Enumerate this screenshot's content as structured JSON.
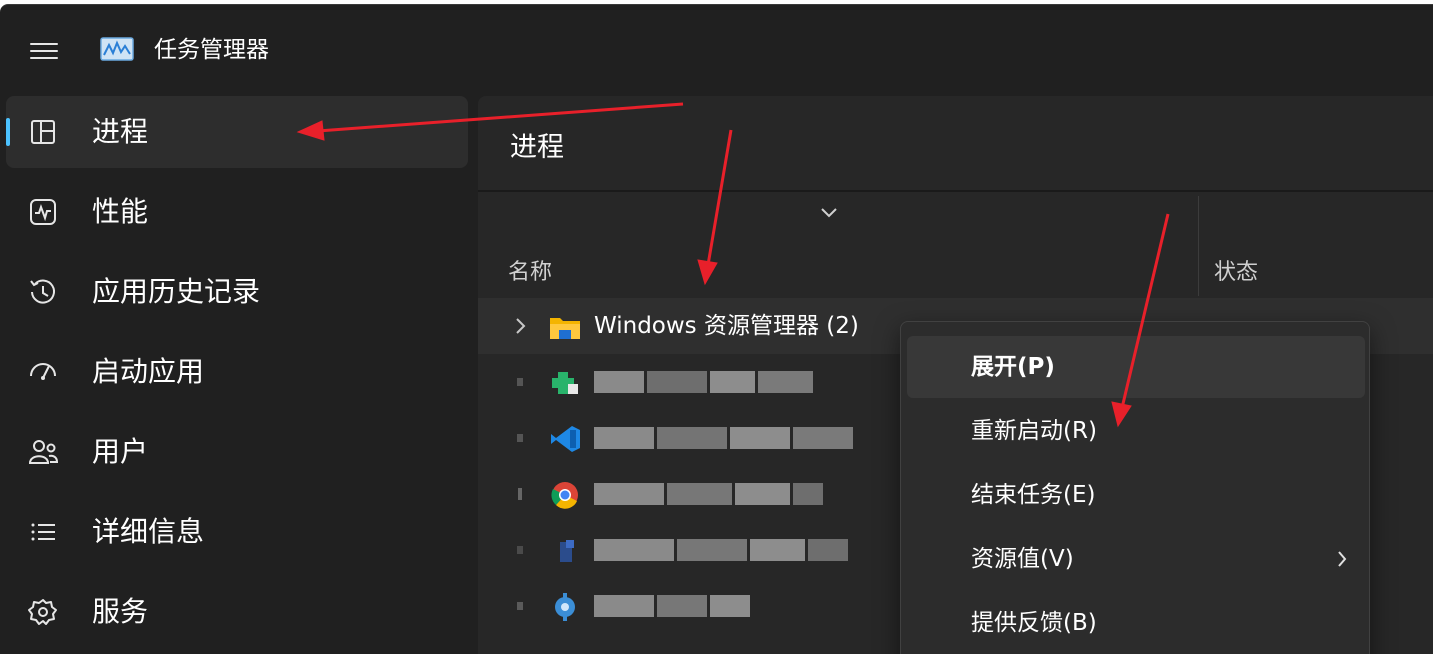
{
  "window": {
    "title": "任务管理器"
  },
  "sidebar": {
    "items": [
      {
        "label": "进程",
        "icon": "processes-icon",
        "active": true
      },
      {
        "label": "性能",
        "icon": "performance-icon"
      },
      {
        "label": "应用历史记录",
        "icon": "app-history-icon"
      },
      {
        "label": "启动应用",
        "icon": "startup-apps-icon"
      },
      {
        "label": "用户",
        "icon": "users-icon"
      },
      {
        "label": "详细信息",
        "icon": "details-icon"
      },
      {
        "label": "服务",
        "icon": "services-icon"
      }
    ]
  },
  "main": {
    "title": "进程",
    "columns": {
      "name": "名称",
      "status": "状态"
    },
    "rows": [
      {
        "label": "Windows 资源管理器 (2)",
        "icon": "file-explorer-icon",
        "expandable": true
      }
    ],
    "blurred_rows": [
      {
        "icon": "green-app-icon"
      },
      {
        "icon": "vscode-icon"
      },
      {
        "icon": "chrome-icon"
      },
      {
        "icon": "blue-app-icon"
      },
      {
        "icon": "gear-app-icon"
      }
    ]
  },
  "context_menu": {
    "items": [
      {
        "label": "展开(P)",
        "bold": true
      },
      {
        "label": "重新启动(R)"
      },
      {
        "label": "结束任务(E)"
      },
      {
        "label": "资源值(V)",
        "has_submenu": true
      },
      {
        "label": "提供反馈(B)"
      }
    ]
  },
  "colors": {
    "window_bg": "#202020",
    "panel_bg": "#272727",
    "accent": "#4cc2ff",
    "annotation_arrow": "#e8202a"
  }
}
